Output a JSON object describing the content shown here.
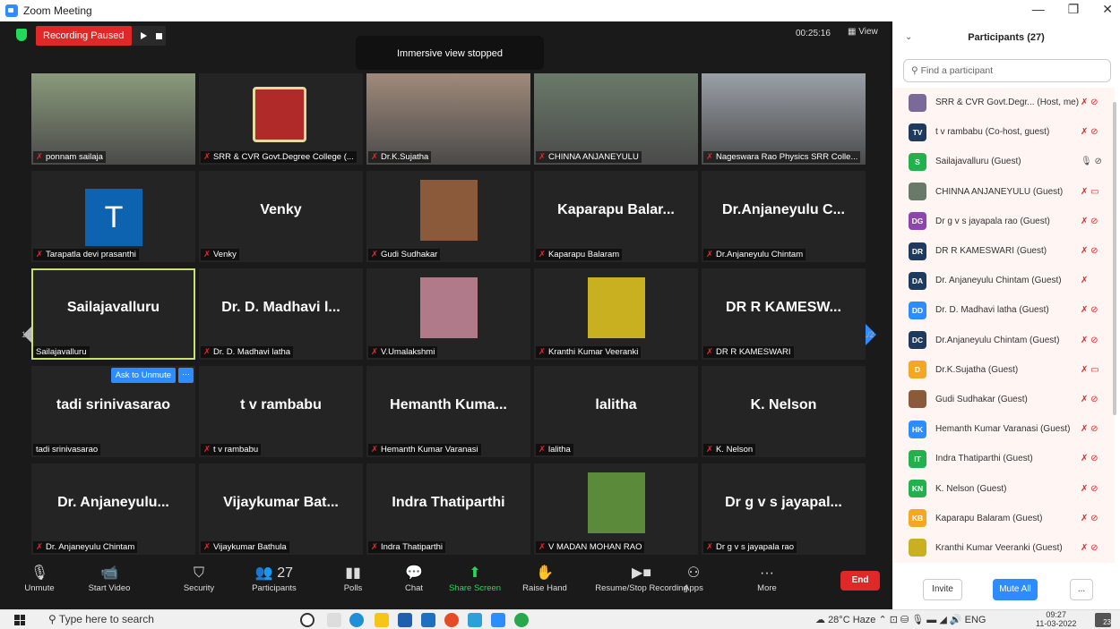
{
  "window": {
    "title": "Zoom Meeting"
  },
  "topbar": {
    "recording": "Recording Paused",
    "toast": "Immersive view stopped",
    "timer": "00:25:16",
    "view": "View"
  },
  "tiles": [
    {
      "name": "",
      "label": "ponnam sailaja",
      "muted": true,
      "kind": "photo",
      "col": "#8a9a7a"
    },
    {
      "name": "",
      "label": "SRR & CVR Govt.Degree College (...",
      "muted": true,
      "kind": "logo"
    },
    {
      "name": "",
      "label": "Dr.K.Sujatha",
      "muted": true,
      "kind": "photo",
      "col": "#a08a7a"
    },
    {
      "name": "",
      "label": "CHINNA ANJANEYULU",
      "muted": true,
      "kind": "photo",
      "col": "#6a7a6a"
    },
    {
      "name": "",
      "label": "Nageswara Rao Physics SRR Colle...",
      "muted": true,
      "kind": "photo",
      "col": "#9aa0a8"
    },
    {
      "name": "",
      "label": "Tarapatla devi prasanthi",
      "muted": true,
      "kind": "avatar",
      "letter": "T"
    },
    {
      "name": "Venky",
      "label": "Venky",
      "muted": true,
      "kind": "name"
    },
    {
      "name": "",
      "label": "Gudi Sudhakar",
      "muted": true,
      "kind": "small",
      "col": "#8a5a3a"
    },
    {
      "name": "Kaparapu  Balar...",
      "label": "Kaparapu Balaram",
      "muted": true,
      "kind": "name"
    },
    {
      "name": "Dr.Anjaneyulu  C...",
      "label": "Dr.Anjaneyulu Chintam",
      "muted": true,
      "kind": "name"
    },
    {
      "name": "Sailajavalluru",
      "label": "Sailajavalluru",
      "muted": false,
      "kind": "name",
      "speaking": true
    },
    {
      "name": "Dr. D. Madhavi l...",
      "label": "Dr. D. Madhavi latha",
      "muted": true,
      "kind": "name"
    },
    {
      "name": "",
      "label": "V.Umalakshmi",
      "muted": true,
      "kind": "small",
      "col": "#b07a8a"
    },
    {
      "name": "",
      "label": "Kranthi Kumar Veeranki",
      "muted": true,
      "kind": "small",
      "col": "#c8b020"
    },
    {
      "name": "DR R KAMESW...",
      "label": "DR R KAMESWARI",
      "muted": true,
      "kind": "name"
    },
    {
      "name": "tadi srinivasarao",
      "label": "tadi srinivasarao",
      "muted": false,
      "kind": "name",
      "ask": true
    },
    {
      "name": "t v rambabu",
      "label": "t v rambabu",
      "muted": true,
      "kind": "name"
    },
    {
      "name": "Hemanth  Kuma...",
      "label": "Hemanth Kumar Varanasi",
      "muted": true,
      "kind": "name"
    },
    {
      "name": "lalitha",
      "label": "lalitha",
      "muted": true,
      "kind": "name"
    },
    {
      "name": "K. Nelson",
      "label": "K. Nelson",
      "muted": true,
      "kind": "name"
    },
    {
      "name": "Dr.  Anjaneyulu...",
      "label": "Dr. Anjaneyulu Chintam",
      "muted": true,
      "kind": "name"
    },
    {
      "name": "Vijaykumar  Bat...",
      "label": "Vijaykumar Bathula",
      "muted": true,
      "kind": "name"
    },
    {
      "name": "Indra Thatiparthi",
      "label": "Indra Thatiparthi",
      "muted": true,
      "kind": "name"
    },
    {
      "name": "",
      "label": "V MADAN MOHAN RAO",
      "muted": true,
      "kind": "small",
      "col": "#5a8a3a"
    },
    {
      "name": "Dr g v s jayapal...",
      "label": "Dr g v s jayapala rao",
      "muted": true,
      "kind": "name"
    }
  ],
  "grid": {
    "ask_unmute": "Ask to Unmute",
    "more": "···",
    "page_left": "1/2",
    "page_right": "1/2"
  },
  "toolbar": [
    {
      "label": "Unmute",
      "icon": "mic-off-icon",
      "glyph": "🎙"
    },
    {
      "label": "Start Video",
      "icon": "video-off-icon",
      "glyph": "📹"
    },
    {
      "label": "Security",
      "icon": "shield-icon",
      "glyph": "⛉"
    },
    {
      "label": "Participants",
      "icon": "participants-icon",
      "glyph": "👥 27"
    },
    {
      "label": "Polls",
      "icon": "polls-icon",
      "glyph": "▮▮"
    },
    {
      "label": "Chat",
      "icon": "chat-icon",
      "glyph": "💬"
    },
    {
      "label": "Share Screen",
      "icon": "share-screen-icon",
      "glyph": "⬆"
    },
    {
      "label": "Raise Hand",
      "icon": "raise-hand-icon",
      "glyph": "✋"
    },
    {
      "label": "Resume/Stop Recording",
      "icon": "record-icon",
      "glyph": "▶■"
    },
    {
      "label": "Apps",
      "icon": "apps-icon",
      "glyph": "⚇"
    },
    {
      "label": "More",
      "icon": "more-icon",
      "glyph": "···"
    }
  ],
  "end_label": "End",
  "panel": {
    "title": "Participants (27)",
    "search_placeholder": "Find a participant",
    "participants": [
      {
        "name": "SRR & CVR Govt.Degr... (Host, me)",
        "initials": "",
        "color": "#7a6a9a",
        "status": "muted"
      },
      {
        "name": "t v rambabu (Co-host, guest)",
        "initials": "TV",
        "color": "#1f3a5f",
        "status": "muted"
      },
      {
        "name": "Sailajavalluru (Guest)",
        "initials": "S",
        "color": "#23b14d",
        "status": "unmuted"
      },
      {
        "name": "CHINNA ANJANEYULU (Guest)",
        "initials": "",
        "color": "#6a7a6a",
        "status": "muted-video"
      },
      {
        "name": "Dr g v s jayapala rao (Guest)",
        "initials": "DG",
        "color": "#8e44ad",
        "status": "muted"
      },
      {
        "name": "DR R KAMESWARI (Guest)",
        "initials": "DR",
        "color": "#1f3a5f",
        "status": "muted"
      },
      {
        "name": "Dr. Anjaneyulu Chintam (Guest)",
        "initials": "DA",
        "color": "#1f3a5f",
        "status": "muted-only"
      },
      {
        "name": "Dr. D. Madhavi latha (Guest)",
        "initials": "DD",
        "color": "#2d8cff",
        "status": "muted"
      },
      {
        "name": "Dr.Anjaneyulu Chintam (Guest)",
        "initials": "DC",
        "color": "#1f3a5f",
        "status": "muted"
      },
      {
        "name": "Dr.K.Sujatha (Guest)",
        "initials": "D",
        "color": "#f5a623",
        "status": "muted-video"
      },
      {
        "name": "Gudi Sudhakar (Guest)",
        "initials": "",
        "color": "#8a5a3a",
        "status": "muted"
      },
      {
        "name": "Hemanth Kumar Varanasi (Guest)",
        "initials": "HK",
        "color": "#2d8cff",
        "status": "muted"
      },
      {
        "name": "Indra Thatiparthi (Guest)",
        "initials": "IT",
        "color": "#23b14d",
        "status": "muted"
      },
      {
        "name": "K. Nelson (Guest)",
        "initials": "KN",
        "color": "#23b14d",
        "status": "muted"
      },
      {
        "name": "Kaparapu Balaram (Guest)",
        "initials": "KB",
        "color": "#f5a623",
        "status": "muted"
      },
      {
        "name": "Kranthi Kumar Veeranki (Guest)",
        "initials": "",
        "color": "#c8b020",
        "status": "muted"
      }
    ],
    "invite": "Invite",
    "mute_all": "Mute All",
    "more": "..."
  },
  "taskbar": {
    "search": "Type here to search",
    "weather": "28°C Haze",
    "lang": "ENG",
    "time": "09:27",
    "date": "11-03-2022",
    "notif": "23"
  }
}
